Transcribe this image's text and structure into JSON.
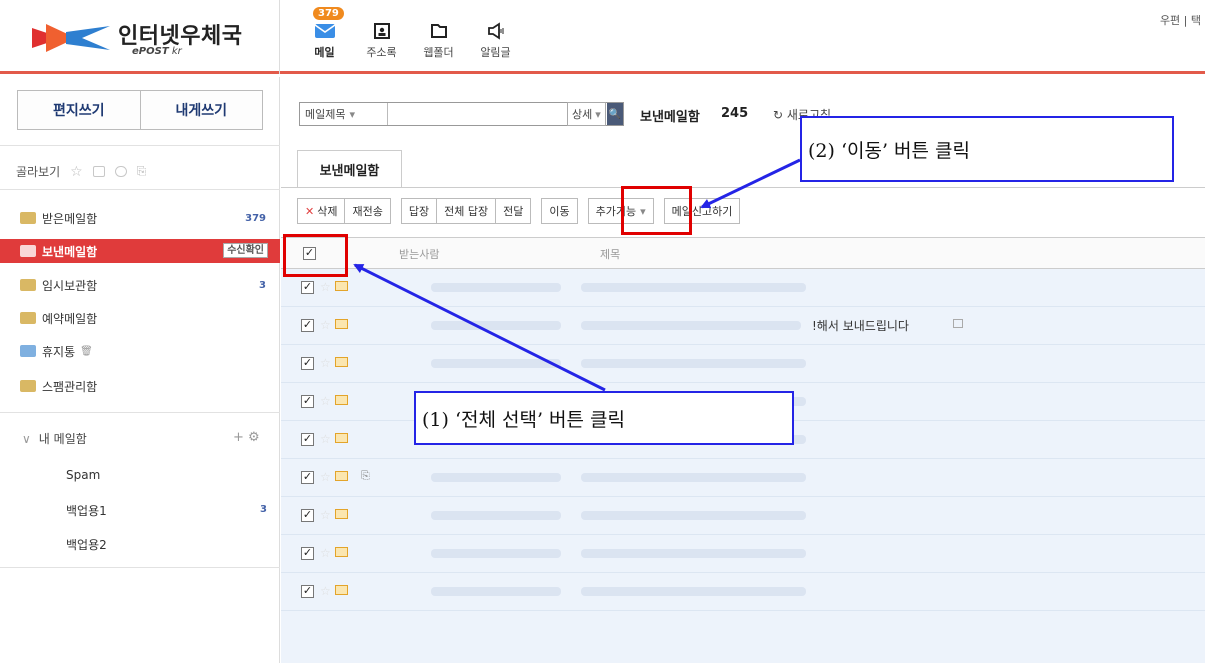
{
  "header": {
    "logo_text": "인터넷우체국",
    "logo_sub_bold": "ePOST",
    "logo_sub": " kr",
    "nav": [
      {
        "label": "메일",
        "badge": "379"
      },
      {
        "label": "주소록"
      },
      {
        "label": "웹폴더"
      },
      {
        "label": "알림글"
      }
    ],
    "top_right": "우편 | 택"
  },
  "sidebar": {
    "compose": "편지쓰기",
    "self_compose": "내게쓰기",
    "filter_label": "골라보기",
    "folders": [
      {
        "label": "받은메일함",
        "count": "379"
      },
      {
        "label": "보낸메일함",
        "badge": "수신확인"
      },
      {
        "label": "임시보관함",
        "count": "3"
      },
      {
        "label": "예약메일함"
      },
      {
        "label": "휴지통"
      },
      {
        "label": "스팸관리함"
      }
    ],
    "my_mailbox": "내 메일함",
    "my_tools": "+ ⚙",
    "subfolders": [
      {
        "label": "Spam"
      },
      {
        "label": "백업용1",
        "count": "3"
      },
      {
        "label": "백업용2"
      }
    ]
  },
  "search": {
    "field": "메일제목",
    "value": "",
    "detail": "상세",
    "mailbox": "보낸메일함",
    "count": "245",
    "refresh": "새로고침"
  },
  "tab": "보낸메일함",
  "toolbar": {
    "delete": "삭제",
    "resend": "재전송",
    "reply": "답장",
    "reply_all": "전체 답장",
    "forward": "전달",
    "move": "이동",
    "more": "추가기능",
    "report": "메일신고하기"
  },
  "list": {
    "headers": {
      "to": "받는사람",
      "subject": "제목"
    },
    "rows": [
      {
        "checked": true,
        "subject": ""
      },
      {
        "checked": true,
        "subject": "!해서 보내드립니다"
      },
      {
        "checked": true,
        "subject": ""
      },
      {
        "checked": true,
        "subject": ""
      },
      {
        "checked": true,
        "subject": ""
      },
      {
        "checked": true,
        "subject": "",
        "attachment": true
      },
      {
        "checked": true,
        "subject": ""
      },
      {
        "checked": true,
        "subject": ""
      },
      {
        "checked": true,
        "subject": ""
      }
    ]
  },
  "annotations": {
    "step1": "(1) ‘전체 선택’ 버튼 클릭",
    "step2": "(2) ‘이동’ 버튼 클릭"
  },
  "colors": {
    "accent_red": "#e03b3b",
    "annotation_blue": "#2424e6",
    "annotation_red": "#e00000"
  }
}
